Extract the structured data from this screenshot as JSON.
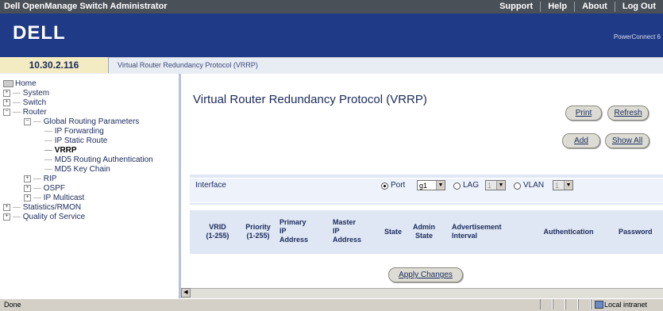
{
  "app_title": "Dell OpenManage Switch Administrator",
  "topnav": [
    "Support",
    "Help",
    "About",
    "Log Out"
  ],
  "brand": {
    "logo": "DELL",
    "product": "PowerConnect 6"
  },
  "ip_address": "10.30.2.116",
  "breadcrumb": "Virtual Router Redundancy Protocol (VRRP)",
  "tree": {
    "home": "Home",
    "system": "System",
    "switch": "Switch",
    "router": "Router",
    "global_routing": "Global Routing Parameters",
    "ip_forwarding": "IP Forwarding",
    "ip_static_route": "IP Static Route",
    "vrrp": "VRRP",
    "md5_auth": "MD5 Routing Authentication",
    "md5_key_chain": "MD5 Key Chain",
    "rip": "RIP",
    "ospf": "OSPF",
    "ip_multicast": "IP Multicast",
    "statistics": "Statistics/RMON",
    "qos": "Quality of Service"
  },
  "page_title": "Virtual Router Redundancy Protocol (VRRP)",
  "buttons": {
    "print": "Print",
    "refresh": "Refresh",
    "add": "Add",
    "show_all": "Show All",
    "apply": "Apply Changes"
  },
  "interface": {
    "label": "Interface",
    "port_label": "Port",
    "port_value": "g1",
    "lag_label": "LAG",
    "lag_value": "1",
    "vlan_label": "VLAN",
    "vlan_value": "1",
    "selected": "Port"
  },
  "table_headers": {
    "vrid": [
      "VRID",
      "(1-255)"
    ],
    "priority": [
      "Priority",
      "(1-255)"
    ],
    "primary_ip": [
      "Primary",
      "IP",
      "Address"
    ],
    "master_ip": [
      "Master",
      "IP",
      "Address"
    ],
    "state": [
      "State"
    ],
    "admin_state": [
      "Admin",
      "State"
    ],
    "adv_interval": [
      "Advertisement",
      "Interval"
    ],
    "authentication": [
      "Authentication"
    ],
    "password": [
      "Password"
    ]
  },
  "status": {
    "text": "Done",
    "zone": "Local intranet"
  }
}
